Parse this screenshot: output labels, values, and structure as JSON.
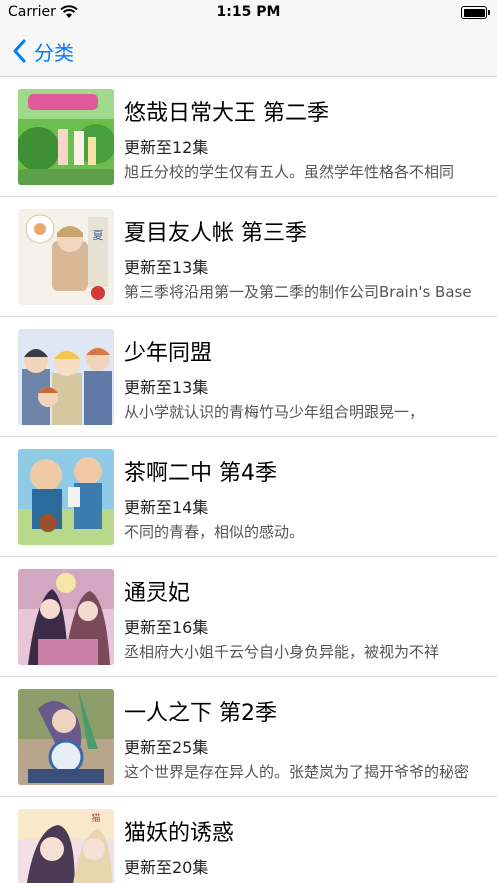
{
  "status_bar": {
    "carrier": "Carrier",
    "time": "1:15 PM"
  },
  "nav": {
    "back_label": "分类"
  },
  "items": [
    {
      "title": "悠哉日常大王 第二季",
      "update": "更新至12集",
      "desc": "旭丘分校的学生仅有五人。虽然学年性格各不相同"
    },
    {
      "title": "夏目友人帐 第三季",
      "update": "更新至13集",
      "desc": "第三季将沿用第一及第二季的制作公司Brain's Base"
    },
    {
      "title": "少年同盟",
      "update": "更新至13集",
      "desc": "从小学就认识的青梅竹马少年组合明跟晃一，"
    },
    {
      "title": "茶啊二中 第4季",
      "update": "更新至14集",
      "desc": "不同的青春，相似的感动。"
    },
    {
      "title": "通灵妃",
      "update": "更新至16集",
      "desc": "丞相府大小姐千云兮自小身负异能，被视为不祥"
    },
    {
      "title": "一人之下 第2季",
      "update": "更新至25集",
      "desc": "这个世界是存在异人的。张楚岚为了揭开爷爷的秘密"
    },
    {
      "title": "猫妖的诱惑",
      "update": "更新至20集",
      "desc": ""
    }
  ]
}
